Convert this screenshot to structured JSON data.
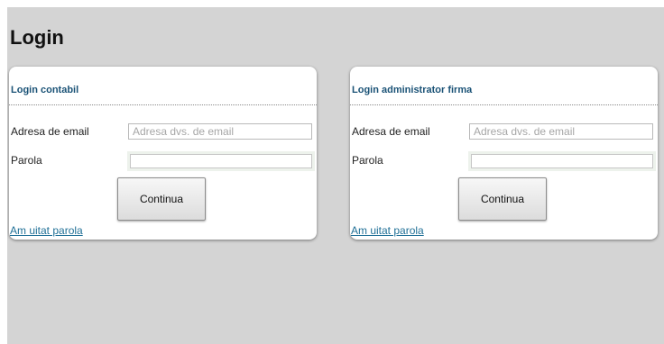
{
  "page": {
    "title": "Login"
  },
  "panels": [
    {
      "title": "Login contabil",
      "email_label": "Adresa de email",
      "email_placeholder": "Adresa dvs. de email",
      "email_value": "",
      "password_label": "Parola",
      "password_value": "",
      "submit_label": "Continua",
      "forgot_label": "Am uitat parola"
    },
    {
      "title": "Login administrator firma",
      "email_label": "Adresa de email",
      "email_placeholder": "Adresa dvs. de email",
      "email_value": "",
      "password_label": "Parola",
      "password_value": "",
      "submit_label": "Continua",
      "forgot_label": "Am uitat parola"
    }
  ],
  "colors": {
    "background": "#d4d4d4",
    "panel": "#ffffff",
    "header_text": "#1a5276",
    "link": "#1f6f96"
  }
}
